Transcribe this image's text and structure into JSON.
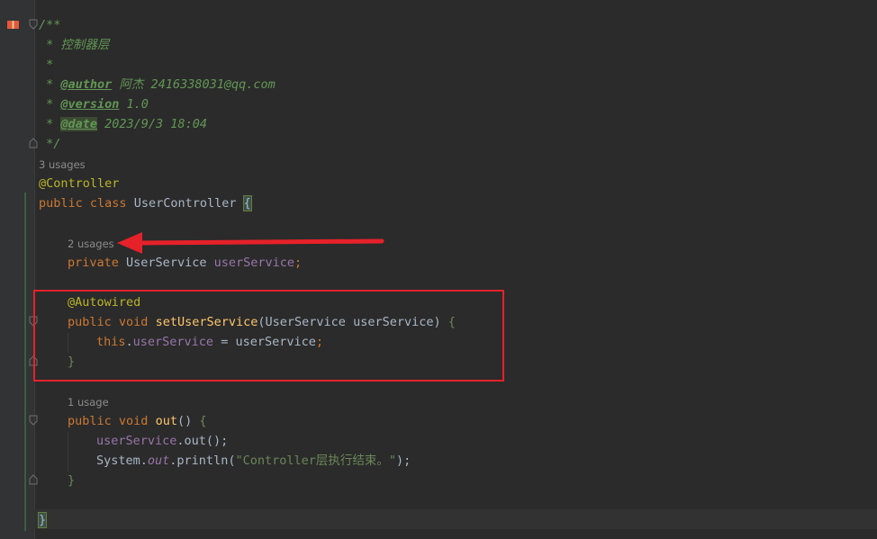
{
  "doc_comment": {
    "open": "/**",
    "line1": " * 控制器层",
    "line2": " *",
    "author_tag": "@author",
    "author_value": " 阿杰 2416338031@qq.com",
    "version_tag": "@version",
    "version_value": " 1.0",
    "date_tag": "@date",
    "date_value": " 2023/9/3 18:04",
    "close": " */",
    "star": " * "
  },
  "hints": {
    "class_usages": "3 usages",
    "field_usages": "2 usages",
    "method_usages": "1 usage"
  },
  "code": {
    "annotation_controller": "@Controller",
    "kw_public": "public",
    "kw_class": "class",
    "class_name": "UserController",
    "open_brace": "{",
    "kw_private": "private",
    "type_user_service": "UserService",
    "field_name": "userService",
    "semicolon": ";",
    "annotation_autowired": "@Autowired",
    "kw_void": "void",
    "setter_name": "setUserService",
    "param_type": "UserService",
    "param_name": "userService",
    "kw_this": "this",
    "assign_rhs": "userService",
    "close_brace": "}",
    "out_method": "out",
    "call_target": "userService",
    "call_out": ".out();",
    "system": "System.",
    "system_out": "out",
    "println": ".println(",
    "string_literal": "\"Controller层执行结束。\"",
    "call_end": ");"
  },
  "colors": {
    "background": "#2b2b2b",
    "keyword": "#cc7832",
    "annotation": "#bbb529",
    "field": "#9876aa",
    "method": "#ffc66d",
    "string": "#6a8759",
    "doc": "#629755",
    "highlight_box": "#e6212a"
  }
}
